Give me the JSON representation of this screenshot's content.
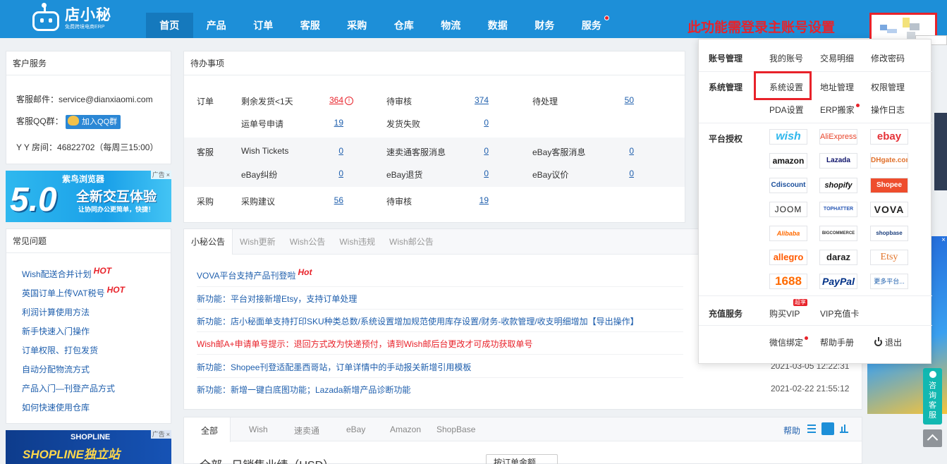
{
  "colors": {
    "brand": "#1d8fd8",
    "link": "#1f5fad",
    "alert": "#e8222a"
  },
  "header": {
    "logo_name": "店小秘",
    "logo_sub": "免费跨境电商ERP",
    "nav": [
      "首页",
      "产品",
      "订单",
      "客服",
      "采购",
      "仓库",
      "物流",
      "数据",
      "财务",
      "服务"
    ],
    "active_nav": "首页",
    "annotation": "此功能需登录主账号设置"
  },
  "service": {
    "title": "客户服务",
    "email": "客服邮件：service@dianxiaomi.com",
    "qq_label": "客服QQ群：",
    "qq_button": "加入QQ群",
    "yy": "Y Y 房间：46822702（每周三15:00）"
  },
  "ad1": {
    "brand": "紫鸟浏览器",
    "version": "5.0",
    "headline": "全新交互体验",
    "sub": "让协同办公更简单，快捷！",
    "tag": "广告",
    "close": "×"
  },
  "faq": {
    "title": "常见问题",
    "hot_label": "HOT",
    "items": [
      {
        "text": "Wish配送合并计划",
        "hot": true
      },
      {
        "text": "英国订单上传VAT税号",
        "hot": true
      },
      {
        "text": "利润计算使用方法",
        "hot": false
      },
      {
        "text": "新手快速入门操作",
        "hot": false
      },
      {
        "text": "订单权限、打包发货",
        "hot": false
      },
      {
        "text": "自动分配物流方式",
        "hot": false
      },
      {
        "text": "产品入门—刊登产品方式",
        "hot": false
      },
      {
        "text": "如何快速使用仓库",
        "hot": false
      }
    ]
  },
  "ad2": {
    "brand": "SHOPLINE",
    "headline": "SHOPLINE独立站",
    "tag": "广告",
    "close": "×"
  },
  "todo": {
    "title": "待办事项",
    "info_glyph": "!",
    "order": {
      "cat": "订单",
      "r1": [
        [
          "剩余发货<1天",
          "364"
        ],
        [
          "待审核",
          "374"
        ],
        [
          "待处理",
          "50"
        ]
      ],
      "r2": [
        [
          "运单号申请",
          "19"
        ],
        [
          "发货失败",
          "0"
        ]
      ]
    },
    "cs": {
      "cat": "客服",
      "r1": [
        [
          "Wish Tickets",
          "0"
        ],
        [
          "速卖通客服消息",
          "0"
        ],
        [
          "eBay客服消息",
          "0"
        ]
      ],
      "r2": [
        [
          "eBay纠纷",
          "0"
        ],
        [
          "eBay退货",
          "0"
        ],
        [
          "eBay议价",
          "0"
        ]
      ]
    },
    "purchase": {
      "cat": "采购",
      "r1": [
        [
          "采购建议",
          "56"
        ],
        [
          "待审核",
          "19"
        ]
      ]
    }
  },
  "notices": {
    "tabs": [
      "小秘公告",
      "Wish更新",
      "Wish公告",
      "Wish违规",
      "Wish邮公告"
    ],
    "hot_label": "Hot",
    "items": [
      {
        "text": "VOVA平台支持产品刊登啦",
        "date": "",
        "red": false,
        "hot": true
      },
      {
        "text": "新功能：平台对接新增Etsy，支持订单处理",
        "date": "",
        "red": false,
        "hot": false
      },
      {
        "text": "新功能：店小秘面单支持打印SKU种类总数/系统设置增加规范使用库存设置/财务-收款管理/收支明细增加【导出操作】",
        "date": "",
        "red": false,
        "hot": false
      },
      {
        "text": "Wish邮A+申请单号提示：退回方式改为快递预付，请到Wish邮后台更改才可成功获取单号",
        "date": "",
        "red": true,
        "hot": false
      },
      {
        "text": "新功能：Shopee刊登适配墨西哥站，订单详情中的手动报关新增引用模板",
        "date": "2021-03-05 12:22:31",
        "red": false,
        "hot": false
      },
      {
        "text": "新功能：新增一键白底图功能；Lazada新增产品诊断功能",
        "date": "2021-02-22 21:55:12",
        "red": false,
        "hot": false
      }
    ]
  },
  "sales": {
    "tabs": [
      "全部",
      "Wish",
      "速卖通",
      "eBay",
      "Amazon",
      "ShopBase"
    ],
    "help": "帮助",
    "heading": "全部   日销售业绩（USD）",
    "select": "按订单金额"
  },
  "menu": {
    "account": {
      "title": "账号管理",
      "items": [
        "我的账号",
        "交易明细",
        "修改密码"
      ]
    },
    "system": {
      "title": "系统管理",
      "items": [
        "系统设置",
        "地址管理",
        "权限管理",
        "PDA设置",
        "ERP搬家",
        "操作日志"
      ]
    },
    "platform": {
      "title": "平台授权",
      "items": [
        "wish",
        "AliExpress",
        "ebay",
        "amazon",
        "Lazada",
        "DHgate.com",
        "Cdiscount",
        "shopify",
        "Shopee",
        "JOOM",
        "TOPHATTER",
        "VOVA",
        "Alibaba",
        "BIGCOMMERCE",
        "shopbase",
        "allegro",
        "daraz",
        "Etsy",
        "1688",
        "PayPal",
        "更多平台..."
      ]
    },
    "recharge": {
      "title": "充值服务",
      "items": [
        "购买VIP",
        "VIP充值卡"
      ],
      "badge": "超享"
    },
    "bottom": [
      "微信绑定",
      "帮助手册",
      "退出"
    ]
  },
  "side": {
    "consult": "咨询客服"
  }
}
